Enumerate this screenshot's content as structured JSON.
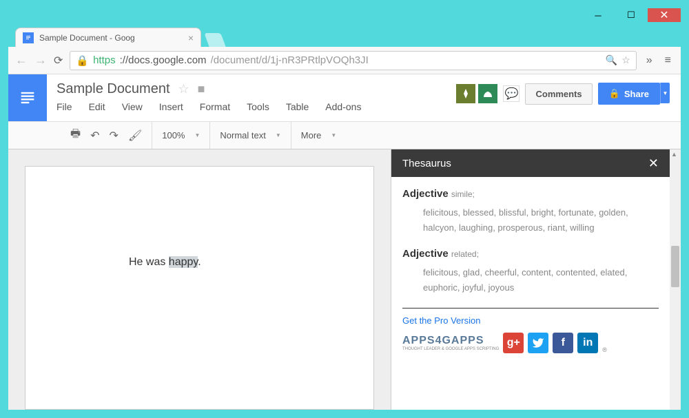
{
  "browser": {
    "tab_title": "Sample Document - Goog",
    "url_scheme": "https",
    "url_host": "://docs.google.com",
    "url_path": "/document/d/1j-nR3PRtlpVOQh3JI"
  },
  "doc": {
    "title": "Sample Document",
    "menu": [
      "File",
      "Edit",
      "View",
      "Insert",
      "Format",
      "Tools",
      "Table",
      "Add-ons"
    ],
    "comments_btn": "Comments",
    "share_btn": "Share"
  },
  "toolbar": {
    "zoom": "100%",
    "style": "Normal text",
    "more": "More"
  },
  "page_text": {
    "prefix": "He was ",
    "highlight": "happy",
    "suffix": "."
  },
  "thesaurus": {
    "title": "Thesaurus",
    "groups": [
      {
        "pos": "Adjective",
        "relation": "simile;",
        "words": "felicitous, blessed, blissful, bright, fortunate, golden, halcyon, laughing, prosperous, riant, willing"
      },
      {
        "pos": "Adjective",
        "relation": "related;",
        "words": "felicitous, glad, cheerful, content, contented, elated, euphoric, joyful, joyous"
      }
    ],
    "pro_link": "Get the Pro Version",
    "brand": "APPS4GAPPS",
    "brand_sub": "THOUGHT LEADER & GOOGLE APPS SCRIPTING"
  }
}
